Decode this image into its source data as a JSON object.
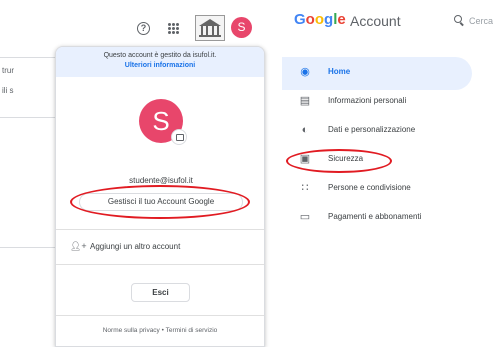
{
  "left_background": {
    "fragments": [
      "trur",
      "ili s"
    ]
  },
  "topbar": {
    "help_icon": "help-circle-icon",
    "apps_icon": "apps-grid-icon",
    "avatar_letter": "S"
  },
  "account_popup": {
    "managed_notice": "Questo account è gestito da isufol.it.",
    "more_info_link": "Ulteriori informazioni",
    "avatar_letter": "S",
    "email": "studente@isufol.it",
    "manage_account_button": "Gestisci il tuo Account Google",
    "add_account_button": "Aggiungi un altro account",
    "exit_button": "Esci",
    "privacy_link": "Norme sulla privacy",
    "separator": "•",
    "terms_link": "Termini di servizio"
  },
  "google_account": {
    "logo": "Google",
    "logo_suffix": "Account",
    "search_placeholder": "Cerca",
    "brand_colors": {
      "blue": "#4285F4",
      "red": "#EA4335",
      "yellow": "#FBBC05",
      "green": "#34A853"
    },
    "nav_items": [
      {
        "label": "Home",
        "icon": "home-person-icon",
        "active": true
      },
      {
        "label": "Informazioni personali",
        "icon": "id-card-icon",
        "active": false
      },
      {
        "label": "Dati e personalizzazione",
        "icon": "toggle-icon",
        "active": false
      },
      {
        "label": "Sicurezza",
        "icon": "lock-icon",
        "active": false
      },
      {
        "label": "Persone e condivisione",
        "icon": "people-icon",
        "active": false
      },
      {
        "label": "Pagamenti e abbonamenti",
        "icon": "credit-card-icon",
        "active": false
      }
    ]
  },
  "annotation_color": "#e11b22"
}
